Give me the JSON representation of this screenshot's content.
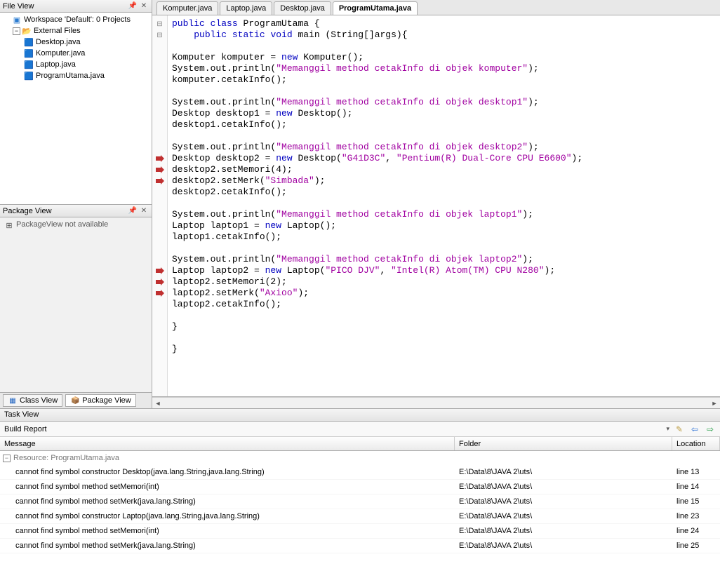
{
  "file_view": {
    "title": "File View",
    "workspace": "Workspace 'Default': 0 Projects",
    "ext_files": "External Files",
    "files": [
      "Desktop.java",
      "Komputer.java",
      "Laptop.java",
      "ProgramUtama.java"
    ]
  },
  "pkg_view": {
    "title": "Package View",
    "msg": "PackageView not available"
  },
  "bottom_tabs": {
    "class": "Class View",
    "pkg": "Package View"
  },
  "editor": {
    "tabs": [
      "Komputer.java",
      "Laptop.java",
      "Desktop.java",
      "ProgramUtama.java"
    ],
    "active": 3,
    "err_lines": [
      13,
      14,
      15,
      23,
      24,
      25
    ]
  },
  "task_view": {
    "title": "Task View",
    "build_report": "Build Report",
    "cols": {
      "msg": "Message",
      "folder": "Folder",
      "loc": "Location"
    },
    "resource": "Resource: ProgramUtama.java",
    "rows": [
      {
        "msg": "cannot find symbol constructor Desktop(java.lang.String,java.lang.String)",
        "folder": "E:\\Data\\8\\JAVA 2\\uts\\",
        "loc": "line 13"
      },
      {
        "msg": "cannot find symbol method setMemori(int)",
        "folder": "E:\\Data\\8\\JAVA 2\\uts\\",
        "loc": "line 14"
      },
      {
        "msg": "cannot find symbol method setMerk(java.lang.String)",
        "folder": "E:\\Data\\8\\JAVA 2\\uts\\",
        "loc": "line 15"
      },
      {
        "msg": "cannot find symbol constructor Laptop(java.lang.String,java.lang.String)",
        "folder": "E:\\Data\\8\\JAVA 2\\uts\\",
        "loc": "line 23"
      },
      {
        "msg": "cannot find symbol method setMemori(int)",
        "folder": "E:\\Data\\8\\JAVA 2\\uts\\",
        "loc": "line 24"
      },
      {
        "msg": "cannot find symbol method setMerk(java.lang.String)",
        "folder": "E:\\Data\\8\\JAVA 2\\uts\\",
        "loc": "line 25"
      }
    ]
  }
}
